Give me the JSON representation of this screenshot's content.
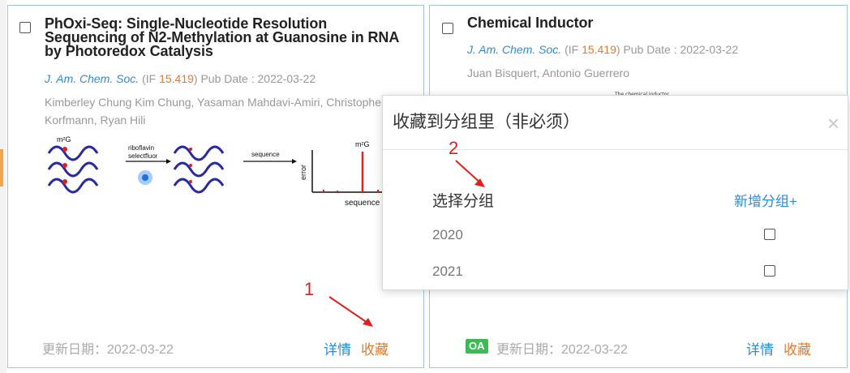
{
  "cards": [
    {
      "title": "PhOxi-Seq: Single-Nucleotide Resolution Sequencing of N2-Methylation at Guanosine in RNA by Photoredox Catalysis",
      "journal": "J. Am. Chem. Soc.",
      "if_open": "(IF ",
      "if_value": "15.419",
      "if_close": ")",
      "pub_date": " Pub Date : 2022-03-22",
      "authors": "Kimberley Chung Kim Chung, Yasaman Mahdavi-Amiri, Christopher Korfmann, Ryan Hili",
      "toc_labels": {
        "m2g_left": "m²G",
        "riboflavin": "riboflavin",
        "selectfluor": "selectfluor",
        "sequence_arrow": "sequence",
        "m2g_right": "m²G",
        "y_axis": "error",
        "x_axis": "sequence"
      },
      "update_date": "更新日期：2022-03-22",
      "detail_label": "详情",
      "favorite_label": "收藏"
    },
    {
      "title": "Chemical Inductor",
      "journal": "J. Am. Chem. Soc.",
      "if_open": "(IF ",
      "if_value": "15.419",
      "if_close": ")",
      "pub_date": " Pub Date : 2022-03-22",
      "authors": "Juan Bisquert, Antonio Guerrero",
      "preview_text": "The chemical inductor",
      "oa_badge": "OA",
      "update_date": "更新日期：2022-03-22",
      "detail_label": "详情",
      "favorite_label": "收藏"
    }
  ],
  "annotations": {
    "one": "1",
    "two": "2"
  },
  "modal": {
    "title": "收藏到分组里（非必须）",
    "close": "×",
    "group_header": "选择分组",
    "new_group": "新增分组+",
    "groups": [
      {
        "name": "2020",
        "checked": false
      },
      {
        "name": "2021",
        "checked": false
      }
    ]
  },
  "colors": {
    "link_blue": "#2d8cd6",
    "accent_orange": "#e8792b",
    "card_border": "#9fc6e9",
    "oa_green": "#3cba54",
    "annotation_red": "#e02020"
  }
}
